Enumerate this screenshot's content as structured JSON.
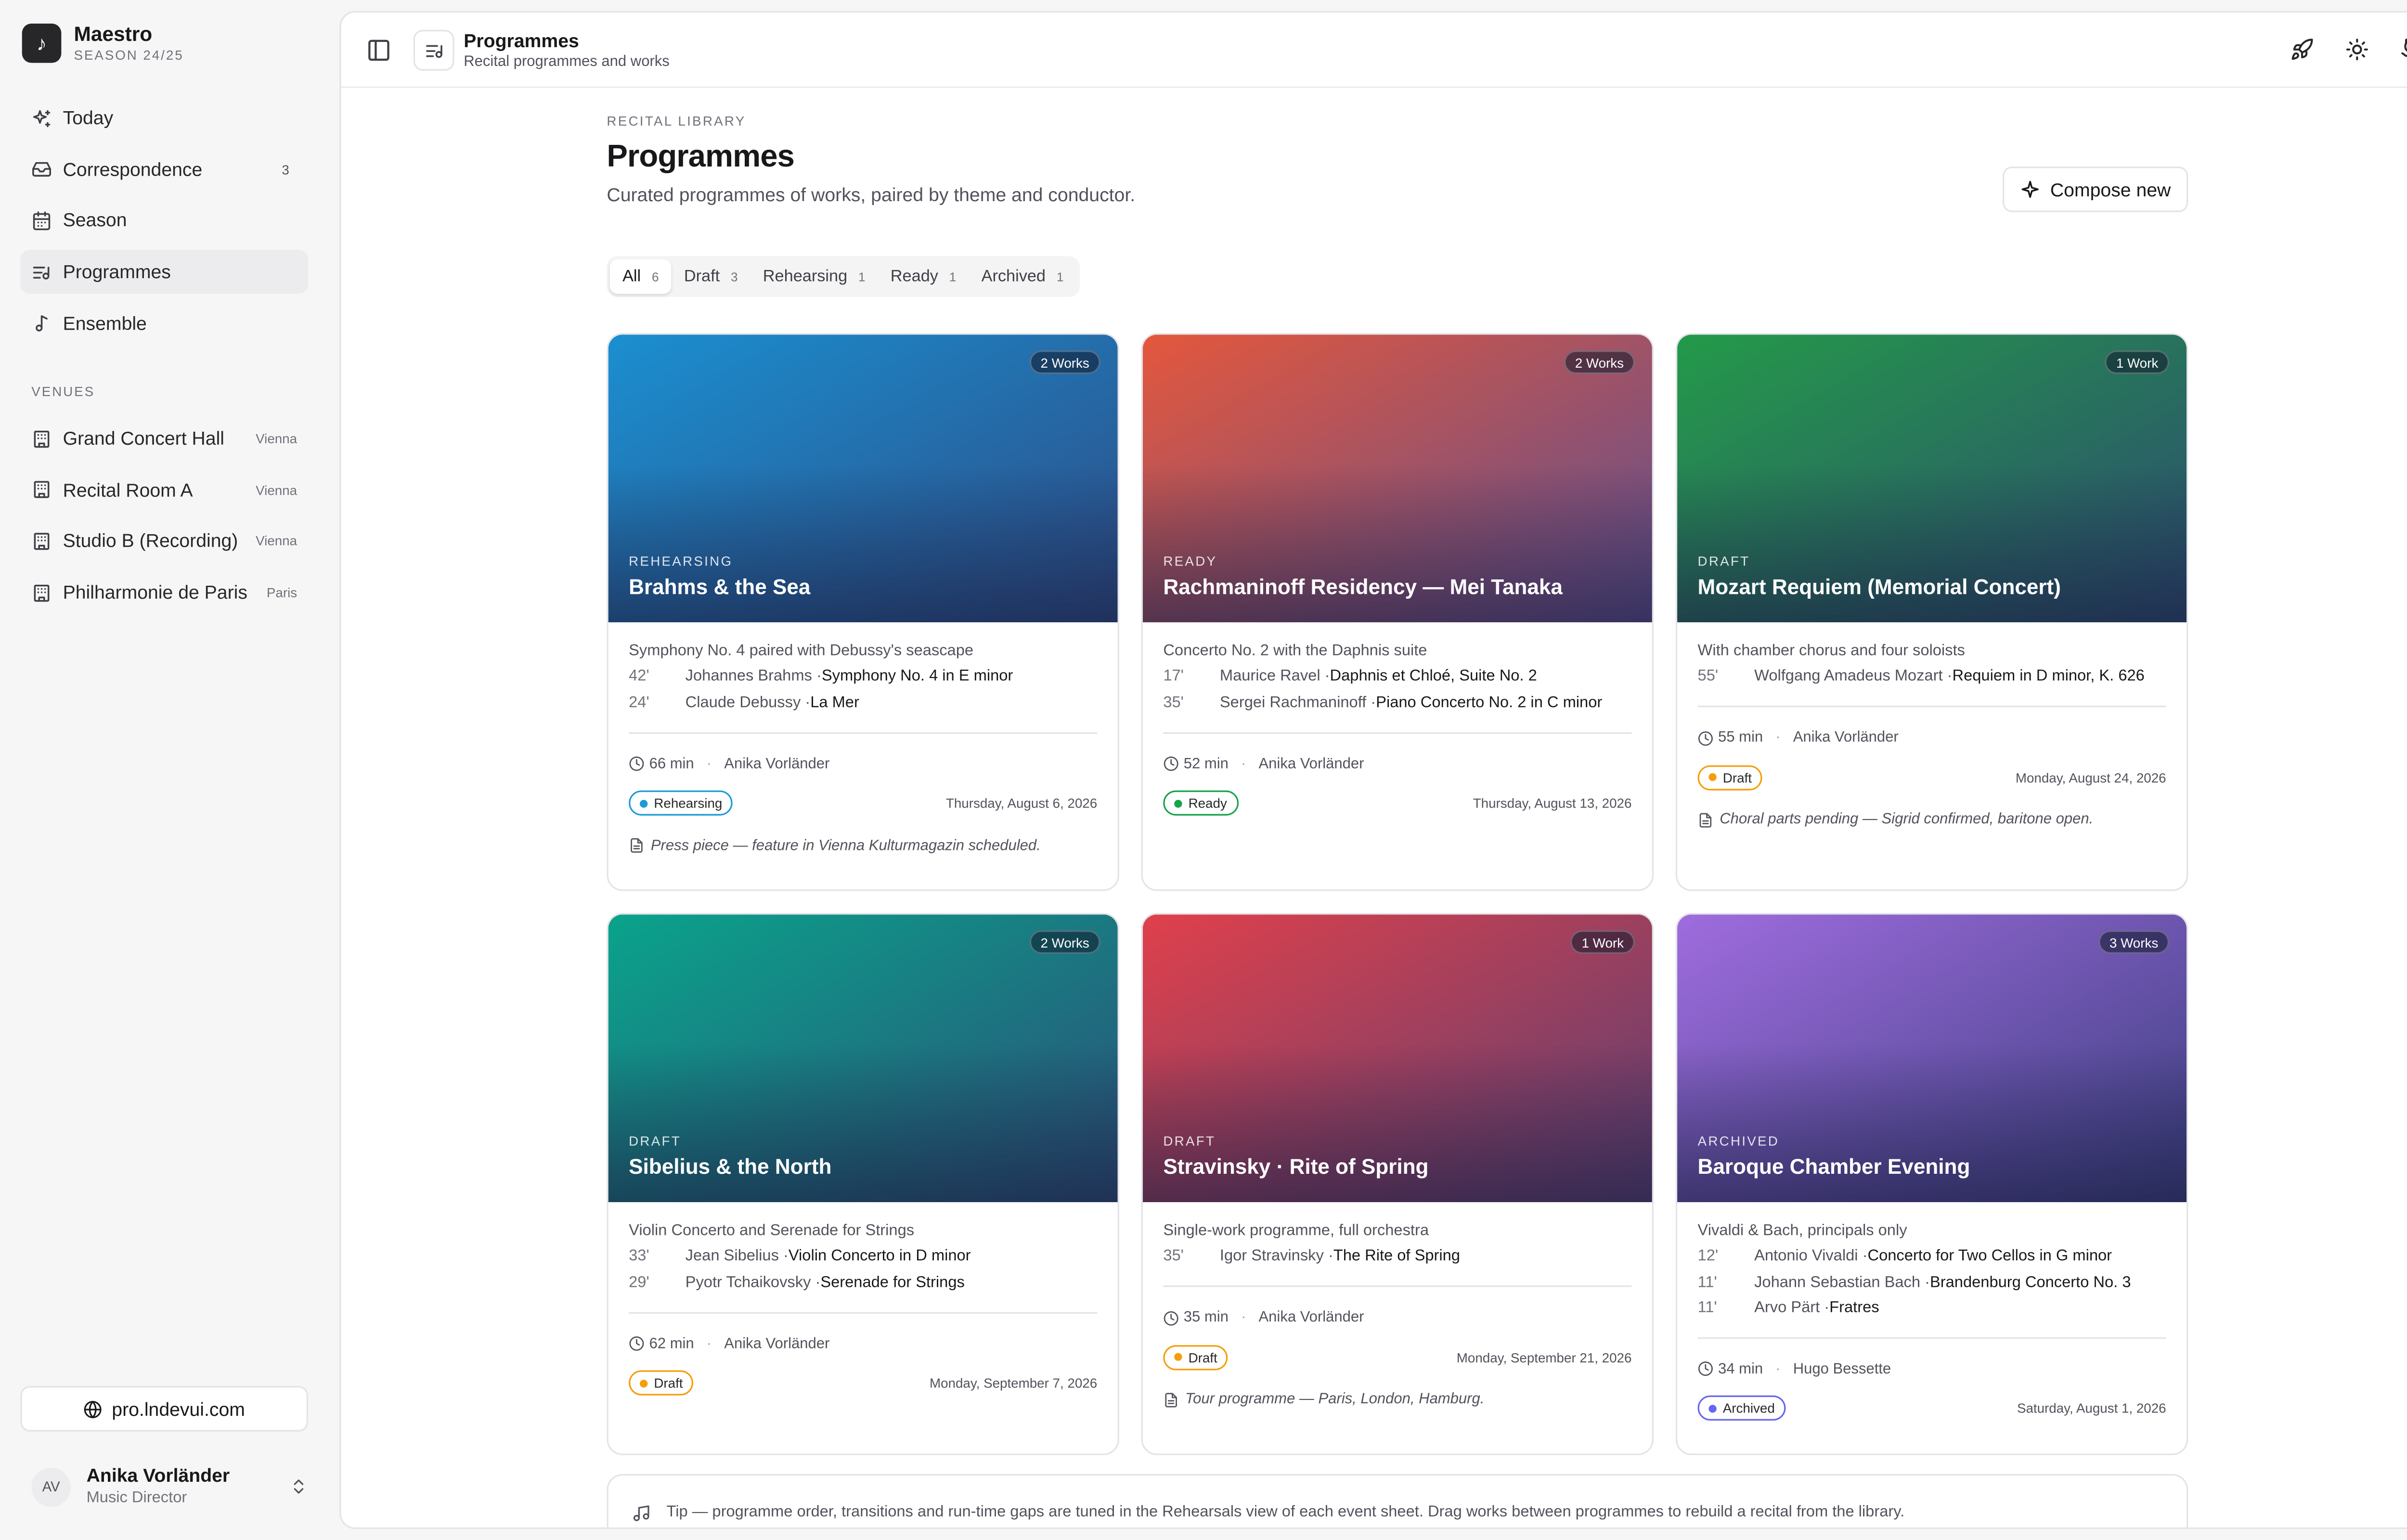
{
  "app": {
    "name": "Maestro",
    "season": "SEASON 24/25"
  },
  "nav": [
    {
      "label": "Today",
      "icon": "sparkles-icon",
      "badge": ""
    },
    {
      "label": "Correspondence",
      "icon": "inbox-icon",
      "badge": "3"
    },
    {
      "label": "Season",
      "icon": "calendar-icon",
      "badge": ""
    },
    {
      "label": "Programmes",
      "icon": "list-music-icon",
      "badge": ""
    },
    {
      "label": "Ensemble",
      "icon": "music-note-icon",
      "badge": ""
    }
  ],
  "venues_heading": "VENUES",
  "venues": [
    {
      "name": "Grand Concert Hall",
      "city": "Vienna"
    },
    {
      "name": "Recital Room A",
      "city": "Vienna"
    },
    {
      "name": "Studio B (Recording)",
      "city": "Vienna"
    },
    {
      "name": "Philharmonie de Paris",
      "city": "Paris"
    }
  ],
  "site_link": "pro.lndevui.com",
  "user": {
    "initials": "AV",
    "name": "Anika Vorländer",
    "role": "Music Director"
  },
  "topbar": {
    "title": "Programmes",
    "subtitle": "Recital programmes and works"
  },
  "page": {
    "eyebrow": "RECITAL LIBRARY",
    "title": "Programmes",
    "description": "Curated programmes of works, paired by theme and conductor.",
    "compose_label": "Compose new"
  },
  "tabs": [
    {
      "label": "All",
      "count": "6"
    },
    {
      "label": "Draft",
      "count": "3"
    },
    {
      "label": "Rehearsing",
      "count": "1"
    },
    {
      "label": "Ready",
      "count": "1"
    },
    {
      "label": "Archived",
      "count": "1"
    }
  ],
  "colors": {
    "rehearsing": "#1d9bd7",
    "ready": "#16a34a",
    "draft": "#f59e0b",
    "archived": "#6366f1"
  },
  "cards": [
    {
      "works": "2 Works",
      "status_caps": "REHEARSING",
      "title": "Brahms & the Sea",
      "subtitle": "Symphony No. 4 paired with Debussy's seascape",
      "pieces": [
        {
          "dur": "42'",
          "composer": "Johannes Brahms · ",
          "work": "Symphony No. 4 in E minor"
        },
        {
          "dur": "24'",
          "composer": "Claude Debussy · ",
          "work": "La Mer"
        }
      ],
      "duration": "66 min",
      "conductor": "Anika Vorländer",
      "status": "Rehearsing",
      "date": "Thursday, August 6, 2026",
      "note": "Press piece — feature in Vienna Kulturmagazin scheduled.",
      "gradient": [
        "#1b8fd0",
        "#2d4c86"
      ]
    },
    {
      "works": "2 Works",
      "status_caps": "READY",
      "title": "Rachmaninoff Residency — Mei Tanaka",
      "subtitle": "Concerto No. 2 with the Daphnis suite",
      "pieces": [
        {
          "dur": "17'",
          "composer": "Maurice Ravel · ",
          "work": "Daphnis et Chloé, Suite No. 2"
        },
        {
          "dur": "35'",
          "composer": "Sergei Rachmaninoff · ",
          "work": "Piano Concerto No. 2 in C minor"
        }
      ],
      "duration": "52 min",
      "conductor": "Anika Vorländer",
      "status": "Ready",
      "date": "Thursday, August 13, 2026",
      "note": "",
      "gradient": [
        "#e4573c",
        "#5f4f8f"
      ]
    },
    {
      "works": "1 Work",
      "status_caps": "DRAFT",
      "title": "Mozart Requiem (Memorial Concert)",
      "subtitle": "With chamber chorus and four soloists",
      "pieces": [
        {
          "dur": "55'",
          "composer": "Wolfgang Amadeus Mozart · ",
          "work": "Requiem in D minor, K. 626"
        }
      ],
      "duration": "55 min",
      "conductor": "Anika Vorländer",
      "status": "Draft",
      "date": "Monday, August 24, 2026",
      "note": "Choral parts pending — Sigrid confirmed, baritone open.",
      "gradient": [
        "#249a49",
        "#2c4b70"
      ]
    },
    {
      "works": "2 Works",
      "status_caps": "DRAFT",
      "title": "Sibelius & the North",
      "subtitle": "Violin Concerto and Serenade for Strings",
      "pieces": [
        {
          "dur": "33'",
          "composer": "Jean Sibelius · ",
          "work": "Violin Concerto in D minor"
        },
        {
          "dur": "29'",
          "composer": "Pyotr Tchaikovsky · ",
          "work": "Serenade for Strings"
        }
      ],
      "duration": "62 min",
      "conductor": "Anika Vorländer",
      "status": "Draft",
      "date": "Monday, September 7, 2026",
      "note": "",
      "gradient": [
        "#0aa38b",
        "#2b4f78"
      ]
    },
    {
      "works": "1 Work",
      "status_caps": "DRAFT",
      "title": "Stravinsky · Rite of Spring",
      "subtitle": "Single-work programme, full orchestra",
      "pieces": [
        {
          "dur": "35'",
          "composer": "Igor Stravinsky · ",
          "work": "The Rite of Spring"
        }
      ],
      "duration": "35 min",
      "conductor": "Anika Vorländer",
      "status": "Draft",
      "date": "Monday, September 21, 2026",
      "note": "Tour programme — Paris, London, Hamburg.",
      "gradient": [
        "#e0404b",
        "#5a3f72"
      ]
    },
    {
      "works": "3 Works",
      "status_caps": "ARCHIVED",
      "title": "Baroque Chamber Evening",
      "subtitle": "Vivaldi & Bach, principals only",
      "pieces": [
        {
          "dur": "12'",
          "composer": "Antonio Vivaldi · ",
          "work": "Concerto for Two Cellos in G minor"
        },
        {
          "dur": "11'",
          "composer": "Johann Sebastian Bach · ",
          "work": "Brandenburg Concerto No. 3"
        },
        {
          "dur": "11'",
          "composer": "Arvo Pärt · ",
          "work": "Fratres"
        }
      ],
      "duration": "34 min",
      "conductor": "Hugo Bessette",
      "status": "Archived",
      "date": "Saturday, August 1, 2026",
      "note": "",
      "gradient": [
        "#9f6cde",
        "#3c3f80"
      ]
    }
  ],
  "tip": "Tip — programme order, transitions and run-time gaps are tuned in the Rehearsals view of each event sheet. Drag works between programmes to rebuild a recital from the library."
}
